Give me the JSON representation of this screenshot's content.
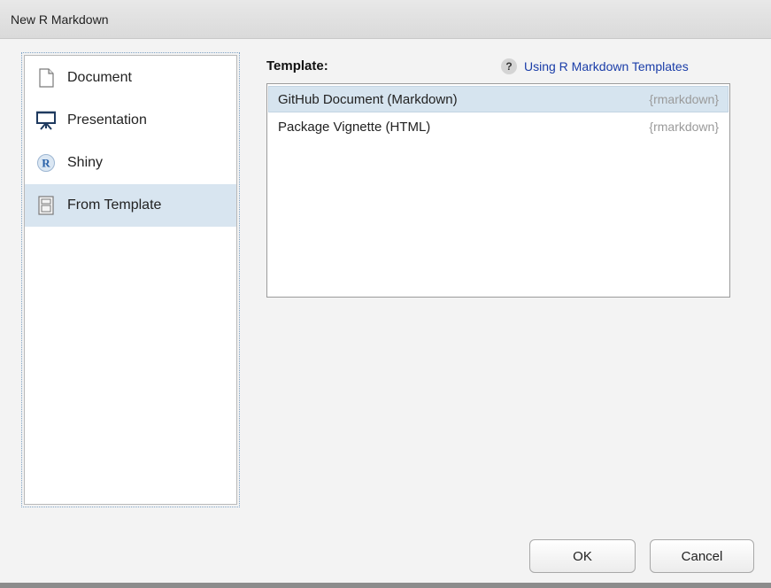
{
  "window": {
    "title": "New R Markdown"
  },
  "types": [
    {
      "label": "Document",
      "icon": "document-icon",
      "selected": false
    },
    {
      "label": "Presentation",
      "icon": "presentation-icon",
      "selected": false
    },
    {
      "label": "Shiny",
      "icon": "shiny-r-icon",
      "selected": false
    },
    {
      "label": "From Template",
      "icon": "template-icon",
      "selected": true
    }
  ],
  "template_section": {
    "label": "Template:",
    "help_icon_glyph": "?",
    "help_link": "Using R Markdown Templates",
    "link_color": "#1a3da8"
  },
  "templates": [
    {
      "name": "GitHub Document (Markdown)",
      "package": "{rmarkdown}",
      "selected": true
    },
    {
      "name": "Package Vignette (HTML)",
      "package": "{rmarkdown}",
      "selected": false
    }
  ],
  "buttons": {
    "ok": "OK",
    "cancel": "Cancel"
  },
  "colors": {
    "selection": "#d8e5f0"
  }
}
